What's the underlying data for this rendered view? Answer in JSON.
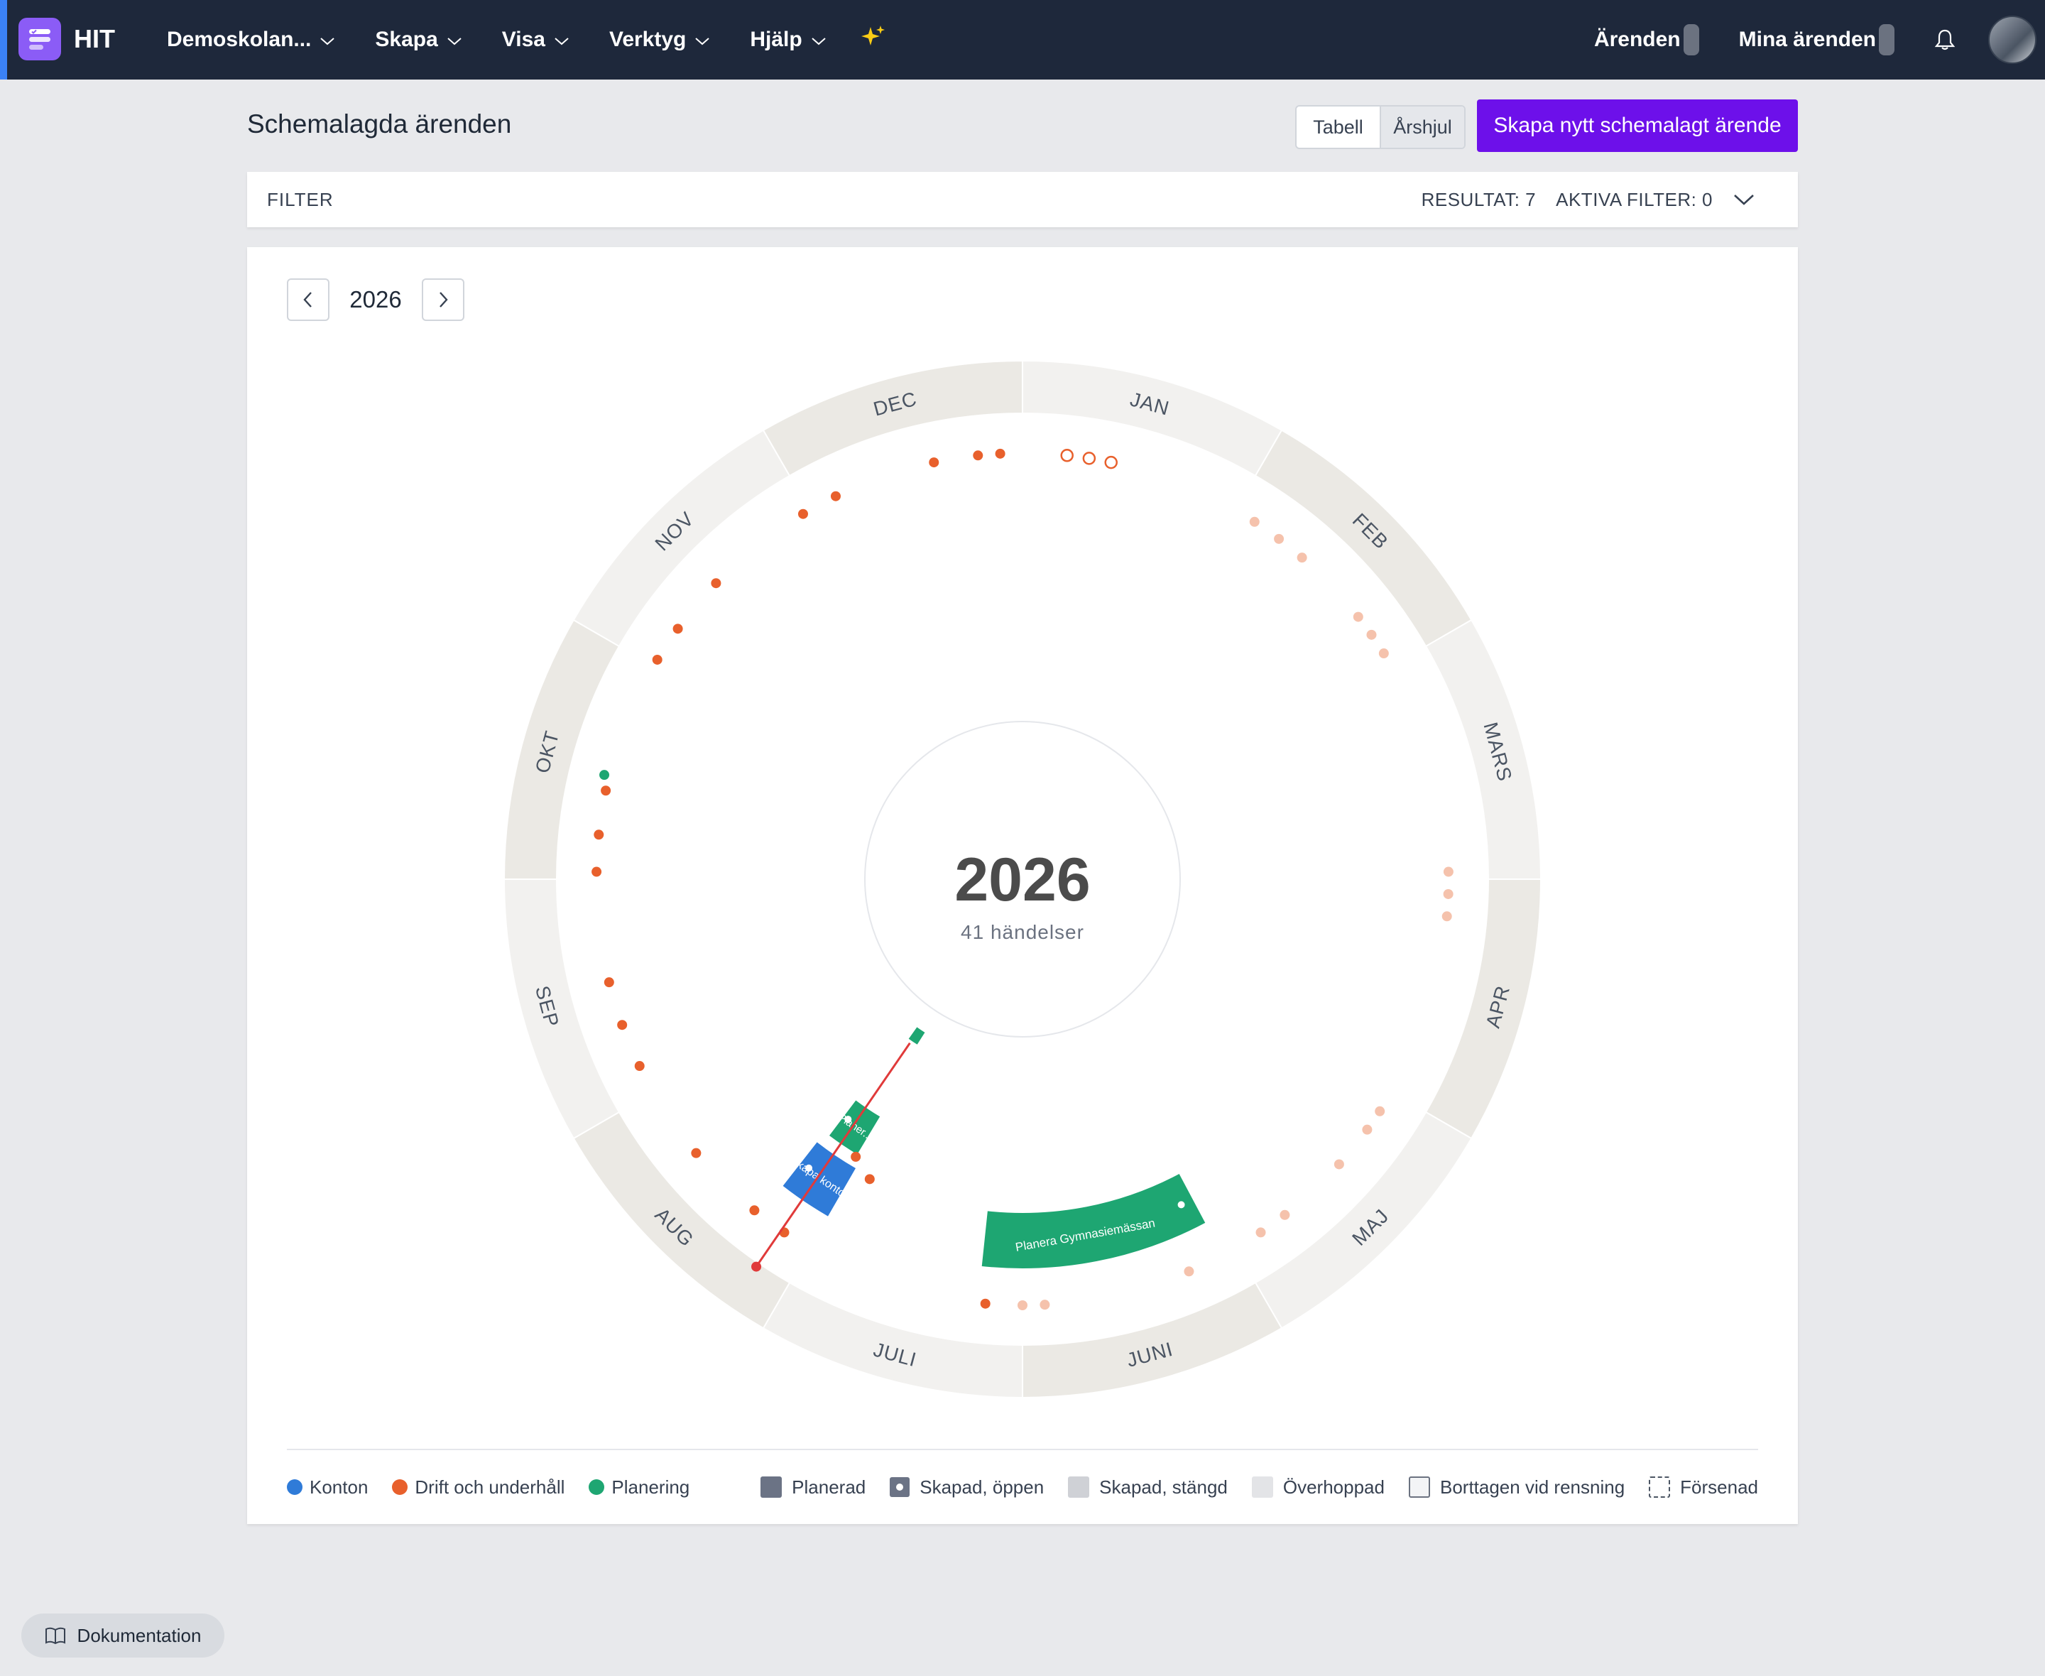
{
  "app": {
    "name": "HIT"
  },
  "nav": {
    "items": [
      {
        "label": "Demoskolan..."
      },
      {
        "label": "Skapa"
      },
      {
        "label": "Visa"
      },
      {
        "label": "Verktyg"
      },
      {
        "label": "Hjälp"
      }
    ],
    "right": {
      "cases_label": "Ärenden",
      "my_cases_label": "Mina ärenden"
    },
    "icons": {
      "sparkle": "sparkle-icon",
      "bell": "bell-icon"
    }
  },
  "page": {
    "title": "Schemalagda ärenden",
    "view_toggle": {
      "table": "Tabell",
      "wheel": "Årshjul",
      "active": "wheel"
    },
    "create_button": "Skapa nytt schemalagt ärende"
  },
  "filter": {
    "label": "FILTER",
    "results": "RESULTAT: 7",
    "active_filters": "AKTIVA FILTER: 0"
  },
  "year_nav": {
    "year": "2026"
  },
  "wheel": {
    "center_year": "2026",
    "center_events": "41 händelser",
    "months": [
      "JAN",
      "FEB",
      "MARS",
      "APR",
      "MAJ",
      "JUNI",
      "JULI",
      "AUG",
      "SEP",
      "OKT",
      "NOV",
      "DEC"
    ],
    "colors": {
      "konton": "#2f7bd8",
      "drift": "#e8602c",
      "planering": "#1ea672",
      "drift_faded": "#f5c2ac",
      "today_line": "#e03a3a"
    },
    "arc_labels": {
      "planera_gymnasiemassan": "Planera Gymnasiemässan",
      "skapa_konton": "Skapa konton",
      "planera": "Planer..."
    }
  },
  "legend": {
    "categories": [
      {
        "label": "Konton",
        "color": "#2f7bd8"
      },
      {
        "label": "Drift och underhåll",
        "color": "#e8602c"
      },
      {
        "label": "Planering",
        "color": "#1ea672"
      }
    ],
    "statuses": [
      {
        "label": "Planerad"
      },
      {
        "label": "Skapad, öppen"
      },
      {
        "label": "Skapad, stängd"
      },
      {
        "label": "Överhoppad"
      },
      {
        "label": "Borttagen vid rensning"
      },
      {
        "label": "Försenad"
      }
    ]
  },
  "docs_button": "Dokumentation"
}
